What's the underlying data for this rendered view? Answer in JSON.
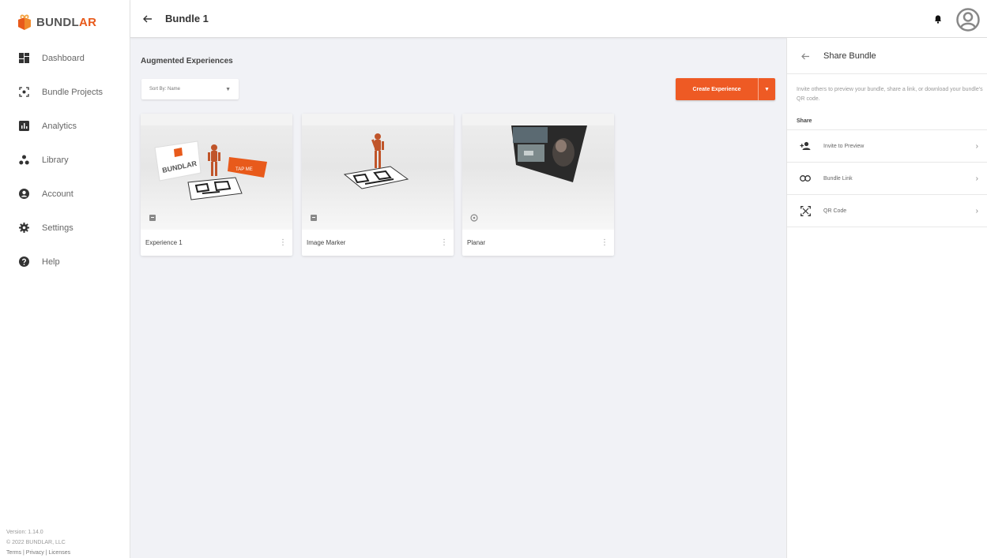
{
  "app": {
    "name_prefix": "BUNDL",
    "name_suffix": "AR",
    "accent_color": "#ee5a24"
  },
  "sidebar": {
    "items": [
      {
        "label": "Dashboard",
        "icon": "dashboard-icon"
      },
      {
        "label": "Bundle Projects",
        "icon": "bundle-projects-icon"
      },
      {
        "label": "Analytics",
        "icon": "analytics-icon"
      },
      {
        "label": "Library",
        "icon": "library-icon"
      },
      {
        "label": "Account",
        "icon": "account-icon"
      },
      {
        "label": "Settings",
        "icon": "gear-icon"
      },
      {
        "label": "Help",
        "icon": "help-icon"
      }
    ],
    "footer": {
      "version": "Version: 1.14.0",
      "copyright": "© 2022 BUNDLAR, LLC",
      "terms": "Terms",
      "privacy": "Privacy",
      "licenses": "Licenses",
      "separator": "|"
    }
  },
  "header": {
    "title": "Bundle 1"
  },
  "main": {
    "section_title": "Augmented Experiences",
    "sort_label": "Sort By: Name",
    "create_button": "Create Experience",
    "cards": [
      {
        "title": "Experience 1",
        "tag_text": "TAP ME",
        "type_icon": "image-marker-icon"
      },
      {
        "title": "Image Marker",
        "type_icon": "image-marker-icon"
      },
      {
        "title": "Planar",
        "type_icon": "planar-icon"
      }
    ]
  },
  "share_panel": {
    "title": "Share Bundle",
    "description": "Invite others to preview your bundle, share a link, or download your bundle's QR code.",
    "section_label": "Share",
    "items": [
      {
        "label": "Invite to Preview",
        "icon": "person-add-icon"
      },
      {
        "label": "Bundle Link",
        "icon": "link-icon"
      },
      {
        "label": "QR Code",
        "icon": "qr-code-icon"
      }
    ]
  }
}
